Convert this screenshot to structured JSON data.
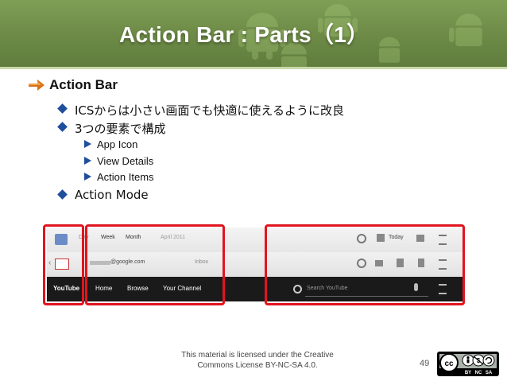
{
  "header": {
    "title": "Action Bar : Parts（1）"
  },
  "content": {
    "bullet1": "Action Bar",
    "sub": [
      {
        "text": "ICSからは小さい画面でも快適に使えるように改良"
      },
      {
        "text": "3つの要素で構成"
      }
    ],
    "parts": [
      {
        "text": "App Icon"
      },
      {
        "text": "View Details"
      },
      {
        "text": "Action Items"
      }
    ],
    "sub2": "Action Mode"
  },
  "screenshot": {
    "row1": {
      "tabs": [
        "Day",
        "Week",
        "Month"
      ],
      "date": "April 2011",
      "today": "Today"
    },
    "row2": {
      "account": "@google.com",
      "folder": "Inbox"
    },
    "row3": {
      "logo": "YouTube",
      "tabs": [
        "Home",
        "Browse",
        "Your Channel"
      ],
      "search_placeholder": "Search YouTube"
    }
  },
  "footer": {
    "license_line1": "This material is licensed under the Creative",
    "license_line2": "Commons License BY-NC-SA 4.0.",
    "page_number": "49",
    "cc_badge_labels": [
      "cc",
      "BY",
      "NC",
      "SA"
    ]
  },
  "colors": {
    "header_green": "#6f8d48",
    "bullet_blue": "#1f4e9c",
    "highlight_red": "#e0151f",
    "bullet_orange": "#d9731a"
  }
}
